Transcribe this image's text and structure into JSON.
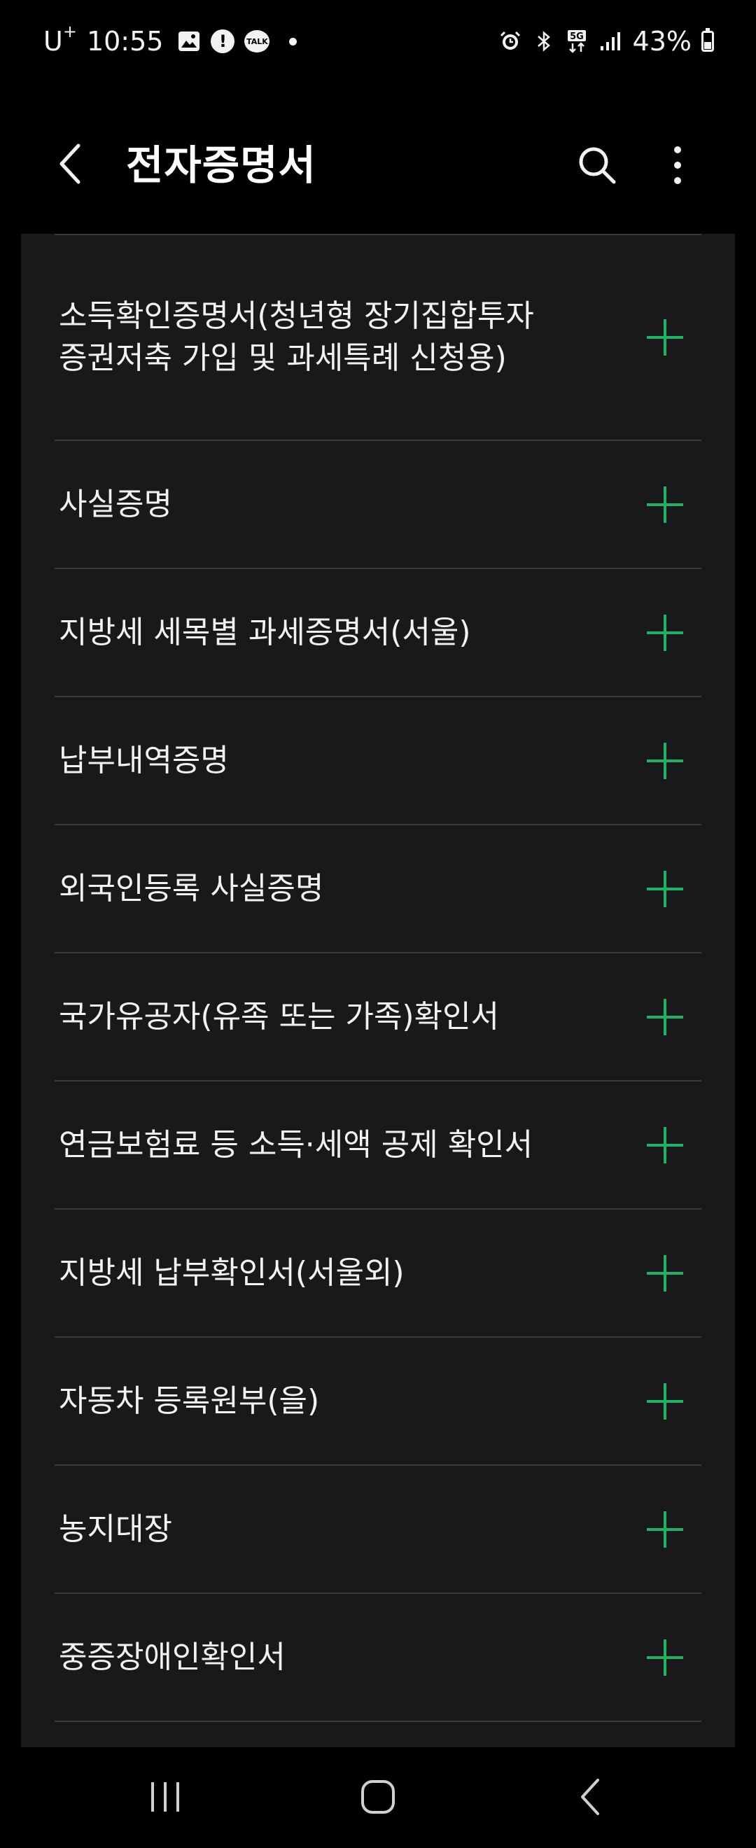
{
  "status_bar": {
    "carrier": "U",
    "carrier_sup": "+",
    "time": "10:55",
    "talk_badge": "TALK",
    "alert_badge": "!",
    "battery": "43%",
    "network": "5G"
  },
  "header": {
    "title": "전자증명서"
  },
  "items": [
    {
      "label": "소득확인증명서(청년형 장기집합투자증권저축 가입 및 과세특례 신청용)"
    },
    {
      "label": "사실증명"
    },
    {
      "label": "지방세 세목별 과세증명서(서울)"
    },
    {
      "label": "납부내역증명"
    },
    {
      "label": "외국인등록 사실증명"
    },
    {
      "label": "국가유공자(유족 또는 가족)확인서"
    },
    {
      "label": "연금보험료 등 소득·세액 공제 확인서"
    },
    {
      "label": "지방세 납부확인서(서울외)"
    },
    {
      "label": "자동차 등록원부(을)"
    },
    {
      "label": "농지대장"
    },
    {
      "label": "중증장애인확인서"
    }
  ],
  "colors": {
    "accent": "#1db364",
    "background": "#000000",
    "card": "#19191b",
    "divider": "#3a3a3c"
  }
}
